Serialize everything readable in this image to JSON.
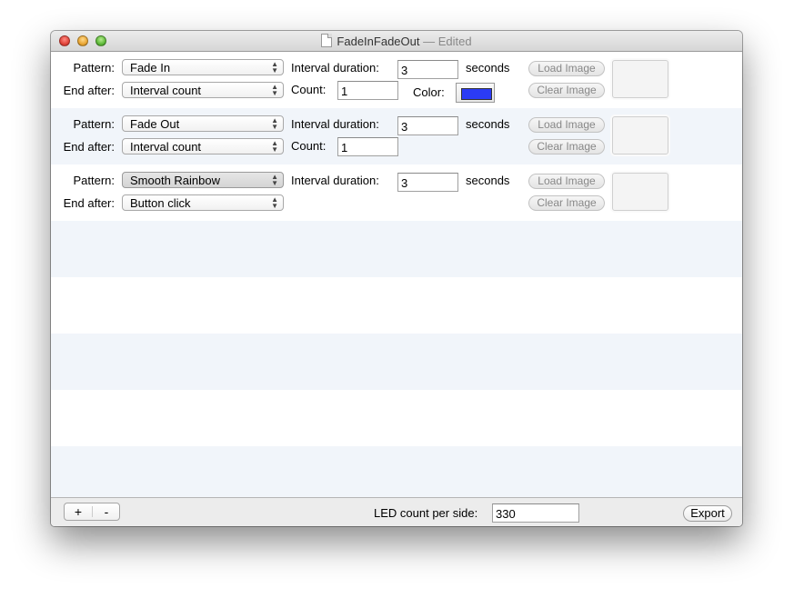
{
  "window": {
    "title": "FadeInFadeOut",
    "title_suffix": " — Edited",
    "controls": [
      "close",
      "minimize",
      "zoom"
    ]
  },
  "labels": {
    "pattern": "Pattern:",
    "end_after": "End after:",
    "interval_duration": "Interval duration:",
    "seconds": "seconds",
    "count": "Count:",
    "color": "Color:",
    "load_image": "Load Image",
    "clear_image": "Clear Image"
  },
  "rows": [
    {
      "pattern": "Fade In",
      "end_after": "Interval count",
      "interval_duration": "3",
      "count": "1",
      "color": "#2b3bf5"
    },
    {
      "pattern": "Fade Out",
      "end_after": "Interval count",
      "interval_duration": "3",
      "count": "1"
    },
    {
      "pattern": "Smooth Rainbow",
      "end_after": "Button click",
      "interval_duration": "3"
    }
  ],
  "footer": {
    "add_label": "+",
    "remove_label": "-",
    "led_count_label": "LED count per side:",
    "led_count_value": "330",
    "export_label": "Export"
  }
}
